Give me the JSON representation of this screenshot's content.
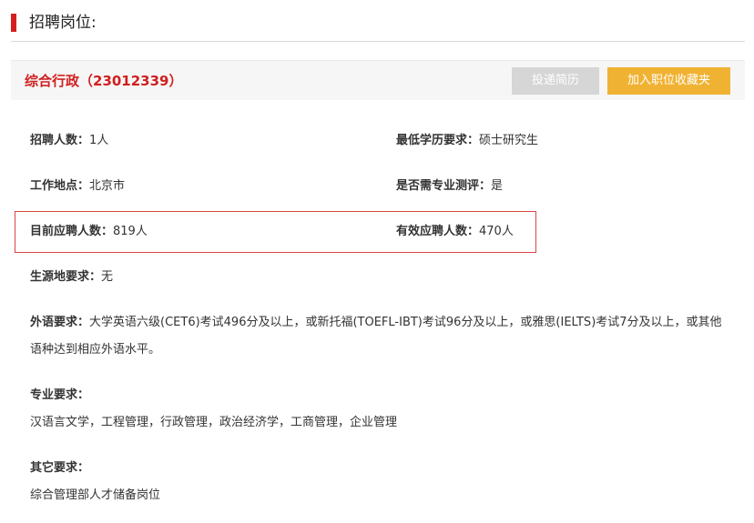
{
  "section": {
    "title": "招聘岗位:"
  },
  "job": {
    "title": "综合行政（23012339）",
    "apply_button": "投递简历",
    "favorite_button": "加入职位收藏夹"
  },
  "fields": {
    "headcount": {
      "label": "招聘人数：",
      "value": "1人"
    },
    "education": {
      "label": "最低学历要求：",
      "value": "硕士研究生"
    },
    "location": {
      "label": "工作地点：",
      "value": "北京市"
    },
    "assessment": {
      "label": "是否需专业测评：",
      "value": "是"
    },
    "current_applicants": {
      "label": "目前应聘人数：",
      "value": "819人"
    },
    "valid_applicants": {
      "label": "有效应聘人数：",
      "value": "470人"
    },
    "origin": {
      "label": "生源地要求：",
      "value": "无"
    }
  },
  "language": {
    "label": "外语要求：",
    "text": "大学英语六级(CET6)考试496分及以上，或新托福(TOEFL-IBT)考试96分及以上，或雅思(IELTS)考试7分及以上，或其他语种达到相应外语水平。"
  },
  "major": {
    "label": "专业要求：",
    "text": "汉语言文学，工程管理，行政管理，政治经济学，工商管理，企业管理"
  },
  "other": {
    "label": "其它要求：",
    "text": "综合管理部人才储备岗位"
  }
}
